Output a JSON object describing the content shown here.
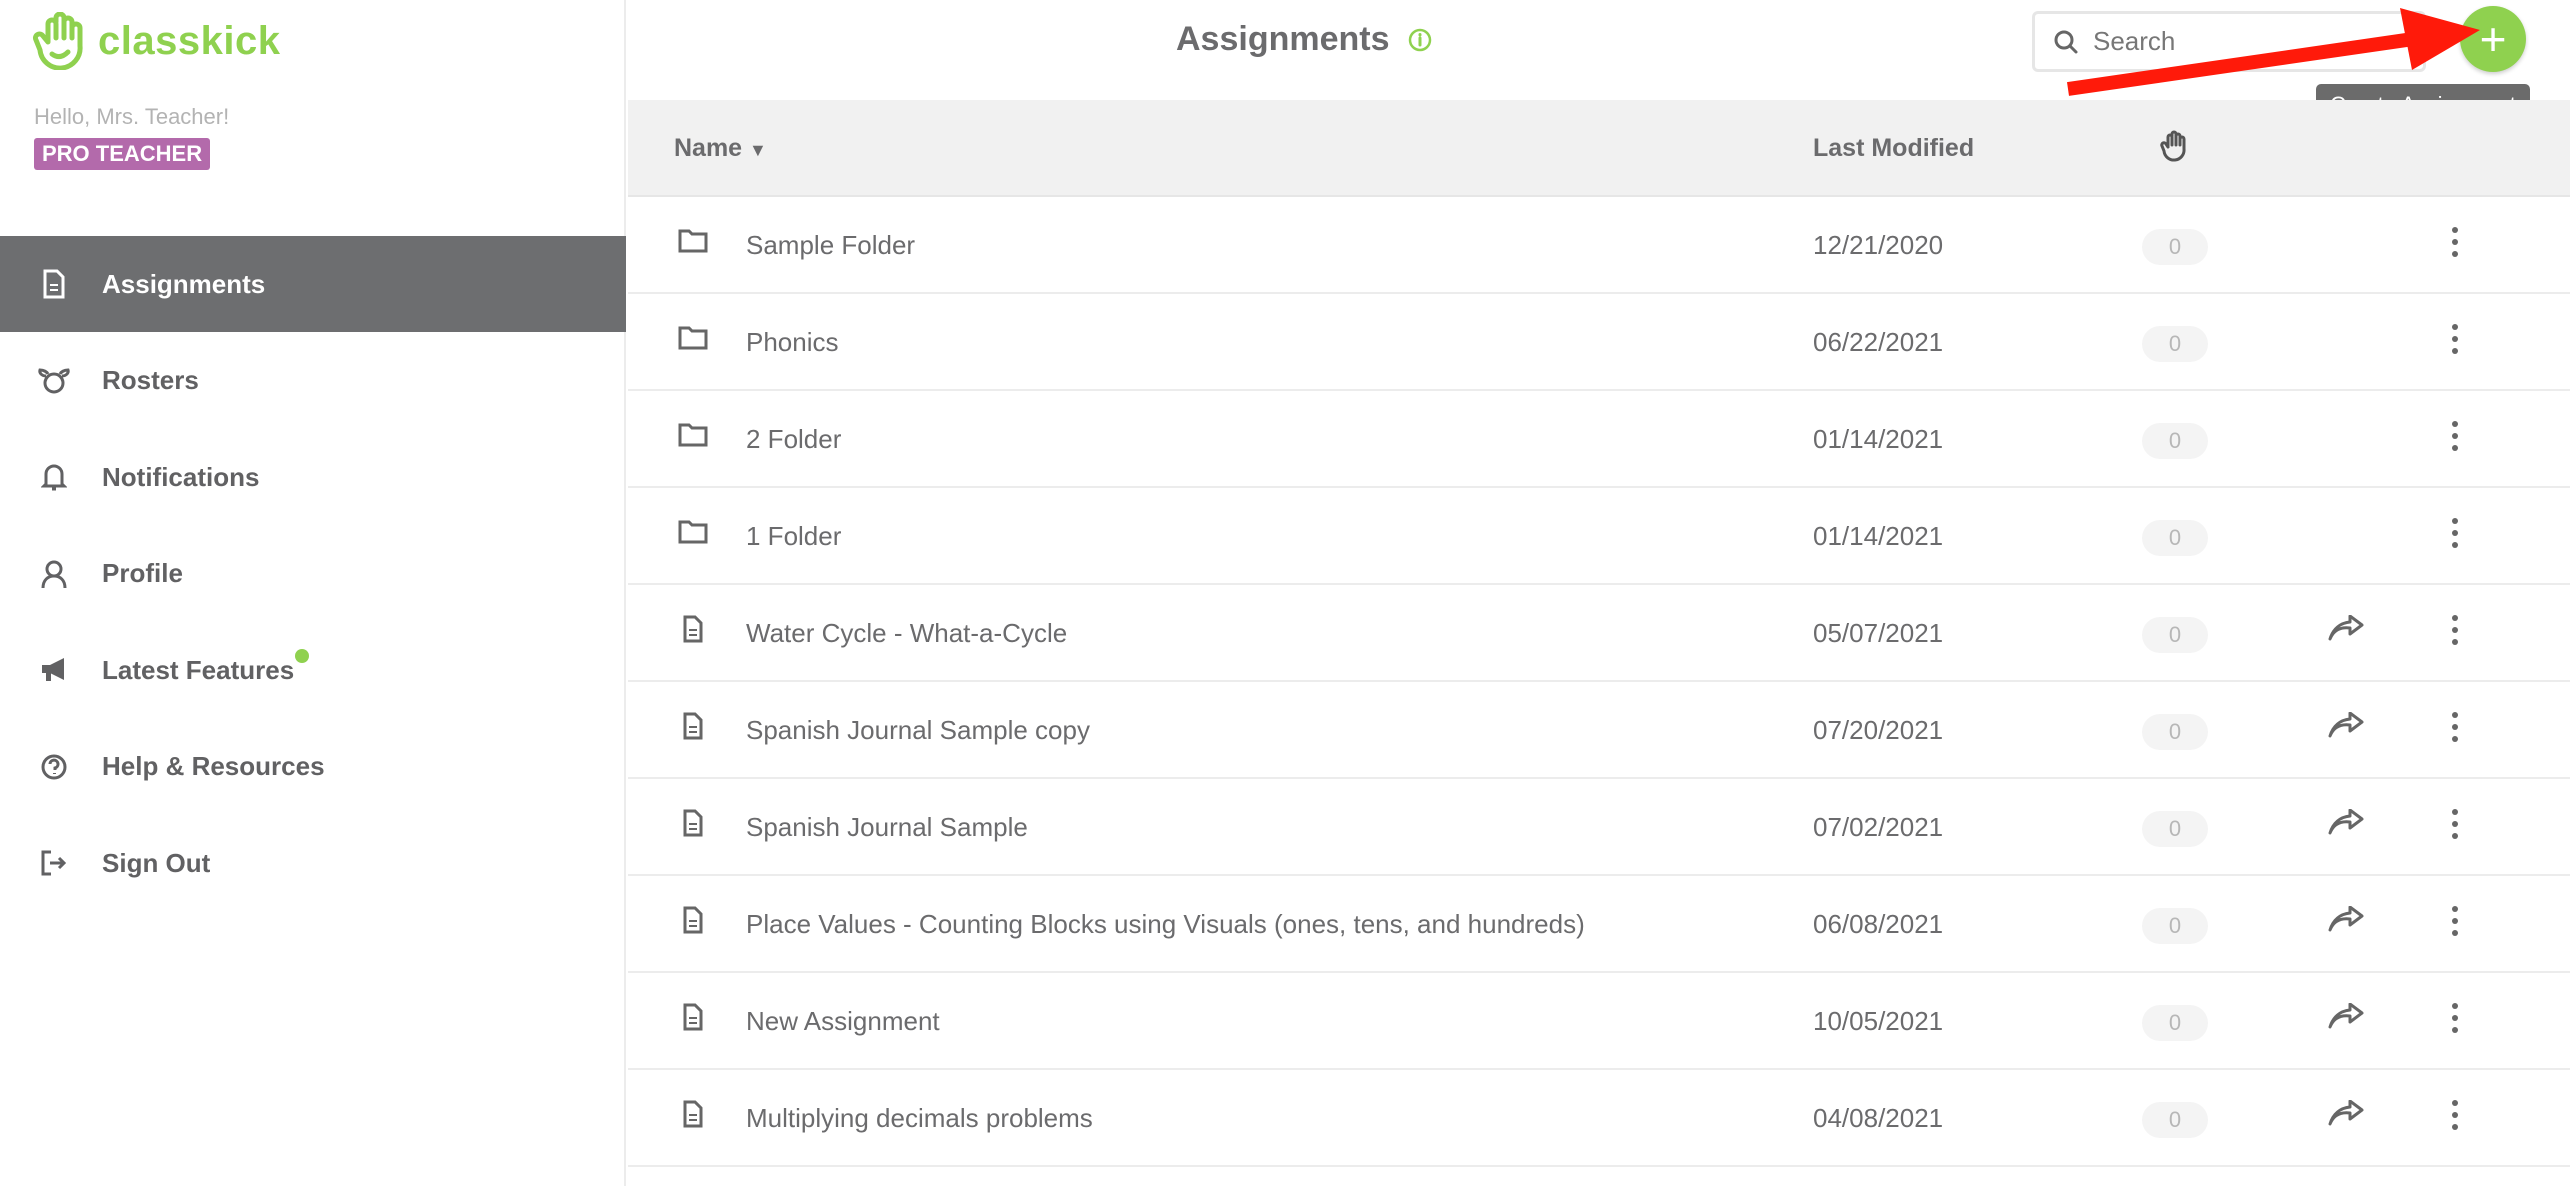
{
  "brand": {
    "name": "classkick",
    "color": "#8fd14f"
  },
  "user": {
    "greeting": "Hello, Mrs. Teacher!",
    "badge": "PRO TEACHER",
    "badge_color": "#b36aab"
  },
  "nav": [
    {
      "label": "Assignments",
      "icon": "document-icon",
      "active": true
    },
    {
      "label": "Rosters",
      "icon": "rosters-icon"
    },
    {
      "label": "Notifications",
      "icon": "bell-icon"
    },
    {
      "label": "Profile",
      "icon": "user-icon"
    },
    {
      "label": "Latest Features",
      "icon": "megaphone-icon",
      "new_dot": true
    },
    {
      "label": "Help & Resources",
      "icon": "help-icon"
    },
    {
      "label": "Sign Out",
      "icon": "sign-out-icon"
    }
  ],
  "header": {
    "title": "Assignments",
    "search_placeholder": "Search",
    "create_tooltip": "Create Assignment"
  },
  "table": {
    "columns": {
      "name": "Name",
      "modified": "Last Modified",
      "hand": "hand-icon"
    },
    "rows": [
      {
        "type": "folder",
        "name": "Sample Folder",
        "modified": "12/21/2020",
        "count": "0"
      },
      {
        "type": "folder",
        "name": "Phonics",
        "modified": "06/22/2021",
        "count": "0"
      },
      {
        "type": "folder",
        "name": "2 Folder",
        "modified": "01/14/2021",
        "count": "0"
      },
      {
        "type": "folder",
        "name": "1 Folder",
        "modified": "01/14/2021",
        "count": "0"
      },
      {
        "type": "assignment",
        "name": "Water Cycle - What-a-Cycle",
        "modified": "05/07/2021",
        "count": "0"
      },
      {
        "type": "assignment",
        "name": "Spanish Journal Sample copy",
        "modified": "07/20/2021",
        "count": "0"
      },
      {
        "type": "assignment",
        "name": "Spanish Journal Sample",
        "modified": "07/02/2021",
        "count": "0"
      },
      {
        "type": "assignment",
        "name": "Place Values - Counting Blocks using Visuals (ones, tens, and hundreds)",
        "modified": "06/08/2021",
        "count": "0"
      },
      {
        "type": "assignment",
        "name": "New Assignment",
        "modified": "10/05/2021",
        "count": "0"
      },
      {
        "type": "assignment",
        "name": "Multiplying decimals problems",
        "modified": "04/08/2021",
        "count": "0"
      }
    ]
  }
}
